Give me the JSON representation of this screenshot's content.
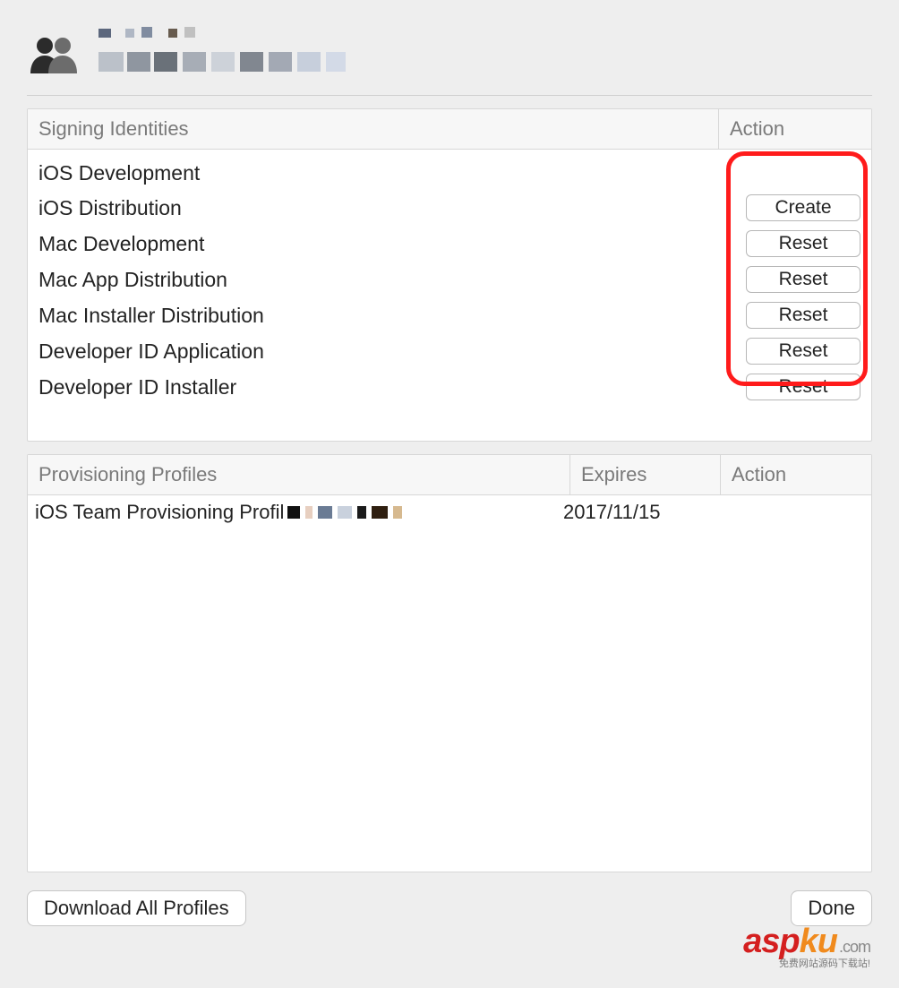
{
  "signing": {
    "header_name": "Signing Identities",
    "header_action": "Action",
    "rows": [
      {
        "name": "iOS Development",
        "action": ""
      },
      {
        "name": "iOS Distribution",
        "action": "Create"
      },
      {
        "name": "Mac Development",
        "action": "Reset"
      },
      {
        "name": "Mac App Distribution",
        "action": "Reset"
      },
      {
        "name": "Mac Installer Distribution",
        "action": "Reset"
      },
      {
        "name": "Developer ID Application",
        "action": "Reset"
      },
      {
        "name": "Developer ID Installer",
        "action": "Reset"
      }
    ]
  },
  "provisioning": {
    "header_name": "Provisioning Profiles",
    "header_expires": "Expires",
    "header_action": "Action",
    "rows": [
      {
        "name": "iOS Team Provisioning Profil",
        "expires": "2017/11/15",
        "action": ""
      }
    ]
  },
  "footer": {
    "download_label": "Download All Profiles",
    "done_label": "Done"
  },
  "watermark": {
    "part1": "asp",
    "part2": "ku",
    "tld": ".com",
    "sub": "免费网站源码下载站!"
  }
}
